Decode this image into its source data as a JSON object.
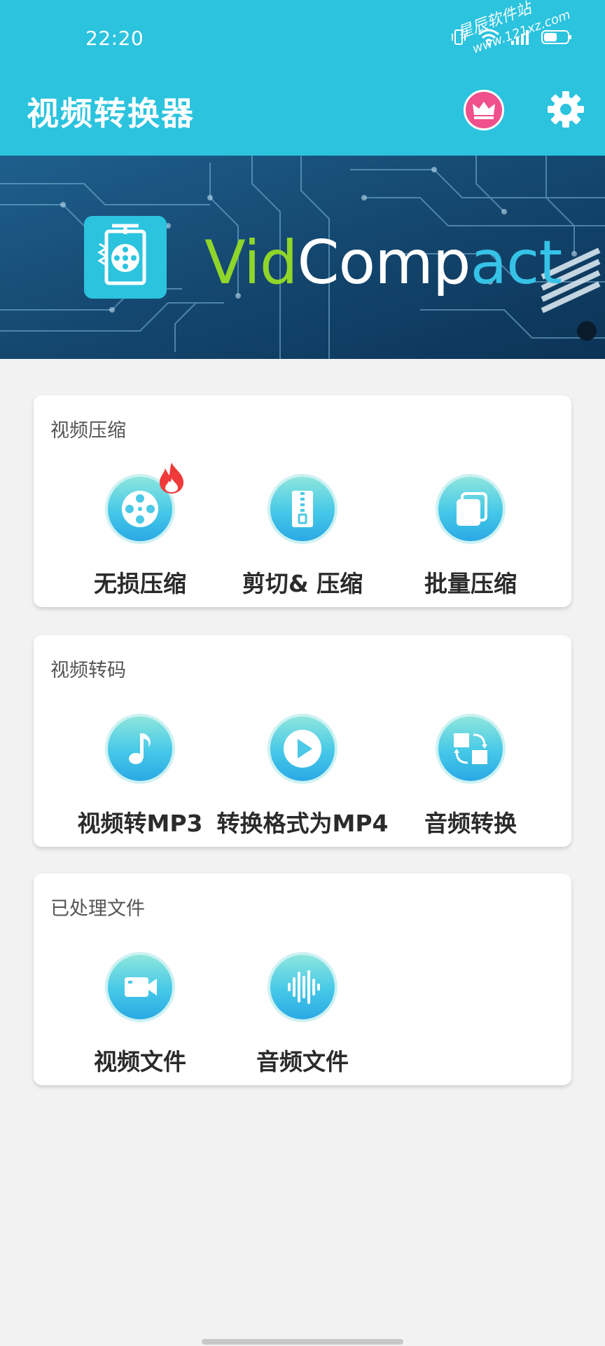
{
  "status_bar": {
    "time": "22:20"
  },
  "watermark": {
    "line1": "星辰软件站",
    "line2": "www.121xz.com"
  },
  "header": {
    "title": "视频转换器"
  },
  "banner": {
    "brand_part1": "Vid",
    "brand_part2": "Comp",
    "brand_part3": "act"
  },
  "sections": [
    {
      "title": "视频压缩",
      "items": [
        {
          "label": "无损压缩",
          "icon": "film-reel-icon",
          "hot": true
        },
        {
          "label": "剪切& 压缩",
          "icon": "zip-file-icon"
        },
        {
          "label": "批量压缩",
          "icon": "stacked-copies-icon"
        }
      ]
    },
    {
      "title": "视频转码",
      "items": [
        {
          "label": "视频转MP3",
          "icon": "music-note-icon"
        },
        {
          "label": "转换格式为MP4",
          "icon": "play-icon"
        },
        {
          "label": "音频转换",
          "icon": "swap-icon"
        }
      ]
    },
    {
      "title": "已处理文件",
      "items": [
        {
          "label": "视频文件",
          "icon": "video-camera-icon"
        },
        {
          "label": "音频文件",
          "icon": "audio-wave-icon"
        }
      ]
    }
  ],
  "colors": {
    "primary": "#2bc3de",
    "vip": "#f0508b",
    "background": "#f2f2f2"
  }
}
